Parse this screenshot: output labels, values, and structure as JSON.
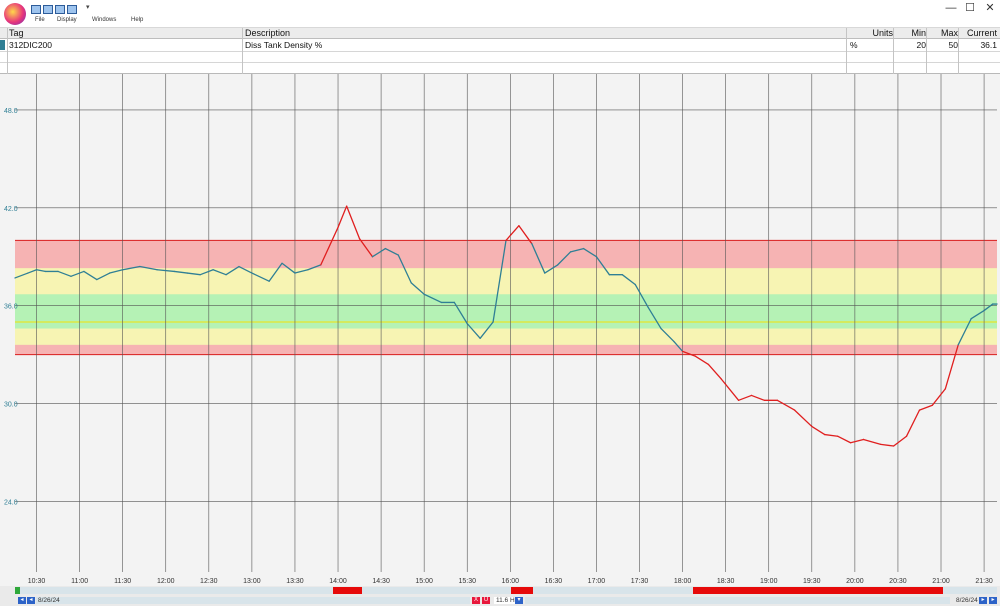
{
  "menu": [
    "File",
    "Display",
    "Windows",
    "Help"
  ],
  "window_controls": {
    "minimize": "—",
    "maximize": "☐",
    "close": "✕"
  },
  "table": {
    "headers": {
      "tag": "Tag",
      "description": "Description",
      "units": "Units",
      "min": "Min",
      "max": "Max",
      "current": "Current"
    },
    "row": {
      "tag": "312DIC200",
      "description": "Diss Tank Density %",
      "units": "%",
      "min": "20",
      "max": "50",
      "current": "36.1"
    }
  },
  "colors": {
    "trend_normal": "#2f7f95",
    "trend_alarm": "#e01f1f",
    "band_outer": "#f6b3b3",
    "band_mid": "#f7f4b3",
    "band_inner": "#b5f2b5",
    "setpoint": "#e6e62a",
    "limit_line": "#d81e1e"
  },
  "status": {
    "start_date": "8/26/24",
    "end_date": "8/26/24",
    "span": "11.6 H",
    "x_btn": "X",
    "u_btn": "U"
  },
  "chart_data": {
    "type": "line",
    "ylim": [
      19.8,
      50.2
    ],
    "xlim": [
      10.25,
      21.65
    ],
    "yticks": [
      {
        "value": 24,
        "label": "24.0"
      },
      {
        "value": 30,
        "label": "30.0"
      },
      {
        "value": 36,
        "label": "36.0"
      },
      {
        "value": 42,
        "label": "42.0"
      },
      {
        "value": 48,
        "label": "48.0"
      }
    ],
    "xticks": [
      {
        "value": 10.5,
        "label": "10:30"
      },
      {
        "value": 11.0,
        "label": "11:00"
      },
      {
        "value": 11.5,
        "label": "11:30"
      },
      {
        "value": 12.0,
        "label": "12:00"
      },
      {
        "value": 12.5,
        "label": "12:30"
      },
      {
        "value": 13.0,
        "label": "13:00"
      },
      {
        "value": 13.5,
        "label": "13:30"
      },
      {
        "value": 14.0,
        "label": "14:00"
      },
      {
        "value": 14.5,
        "label": "14:30"
      },
      {
        "value": 15.0,
        "label": "15:00"
      },
      {
        "value": 15.5,
        "label": "15:30"
      },
      {
        "value": 16.0,
        "label": "16:00"
      },
      {
        "value": 16.5,
        "label": "16:30"
      },
      {
        "value": 17.0,
        "label": "17:00"
      },
      {
        "value": 17.5,
        "label": "17:30"
      },
      {
        "value": 18.0,
        "label": "18:00"
      },
      {
        "value": 18.5,
        "label": "18:30"
      },
      {
        "value": 19.0,
        "label": "19:00"
      },
      {
        "value": 19.5,
        "label": "19:30"
      },
      {
        "value": 20.0,
        "label": "20:00"
      },
      {
        "value": 20.5,
        "label": "20:30"
      },
      {
        "value": 21.0,
        "label": "21:00"
      },
      {
        "value": 21.5,
        "label": "21:30"
      }
    ],
    "bands": [
      {
        "name": "outer",
        "low": 33.0,
        "high": 40.0
      },
      {
        "name": "mid",
        "low": 33.6,
        "high": 38.3
      },
      {
        "name": "inner",
        "low": 34.6,
        "high": 36.7
      }
    ],
    "setpoint": 35.0,
    "series": [
      {
        "points": [
          [
            10.25,
            37.7
          ],
          [
            10.4,
            38.0
          ],
          [
            10.5,
            38.2
          ],
          [
            10.6,
            38.1
          ],
          [
            10.75,
            38.1
          ],
          [
            10.9,
            37.8
          ],
          [
            11.05,
            38.1
          ],
          [
            11.2,
            37.6
          ],
          [
            11.35,
            38.0
          ],
          [
            11.5,
            38.2
          ],
          [
            11.7,
            38.4
          ],
          [
            11.9,
            38.2
          ],
          [
            12.1,
            38.1
          ],
          [
            12.25,
            38.0
          ],
          [
            12.4,
            37.9
          ],
          [
            12.55,
            38.2
          ],
          [
            12.7,
            37.9
          ],
          [
            12.85,
            38.4
          ],
          [
            13.0,
            38.0
          ],
          [
            13.2,
            37.5
          ],
          [
            13.35,
            38.6
          ],
          [
            13.5,
            38.0
          ],
          [
            13.65,
            38.2
          ],
          [
            13.8,
            38.5
          ],
          [
            14.0,
            40.8
          ],
          [
            14.1,
            42.1
          ],
          [
            14.25,
            40.1
          ],
          [
            14.4,
            39.0
          ],
          [
            14.55,
            39.5
          ],
          [
            14.7,
            39.1
          ],
          [
            14.85,
            37.4
          ],
          [
            15.0,
            36.7
          ],
          [
            15.2,
            36.2
          ],
          [
            15.35,
            36.2
          ],
          [
            15.5,
            34.9
          ],
          [
            15.65,
            34.0
          ],
          [
            15.8,
            35.0
          ],
          [
            15.95,
            40.0
          ],
          [
            16.1,
            40.9
          ],
          [
            16.25,
            39.8
          ],
          [
            16.4,
            38.0
          ],
          [
            16.55,
            38.5
          ],
          [
            16.7,
            39.3
          ],
          [
            16.85,
            39.5
          ],
          [
            17.0,
            39.0
          ],
          [
            17.15,
            37.9
          ],
          [
            17.3,
            37.9
          ],
          [
            17.45,
            37.3
          ],
          [
            17.6,
            35.9
          ],
          [
            17.75,
            34.6
          ],
          [
            17.9,
            33.8
          ],
          [
            18.0,
            33.2
          ],
          [
            18.15,
            32.9
          ],
          [
            18.3,
            32.4
          ],
          [
            18.45,
            31.5
          ],
          [
            18.65,
            30.2
          ],
          [
            18.8,
            30.5
          ],
          [
            18.95,
            30.2
          ],
          [
            19.1,
            30.2
          ],
          [
            19.3,
            29.6
          ],
          [
            19.5,
            28.6
          ],
          [
            19.65,
            28.1
          ],
          [
            19.8,
            28.0
          ],
          [
            19.95,
            27.6
          ],
          [
            20.1,
            27.8
          ],
          [
            20.3,
            27.5
          ],
          [
            20.45,
            27.4
          ],
          [
            20.6,
            28.0
          ],
          [
            20.75,
            29.6
          ],
          [
            20.9,
            29.9
          ],
          [
            21.05,
            30.9
          ],
          [
            21.2,
            33.6
          ],
          [
            21.35,
            35.2
          ],
          [
            21.5,
            35.7
          ],
          [
            21.6,
            36.1
          ],
          [
            21.65,
            36.1
          ]
        ]
      }
    ]
  }
}
